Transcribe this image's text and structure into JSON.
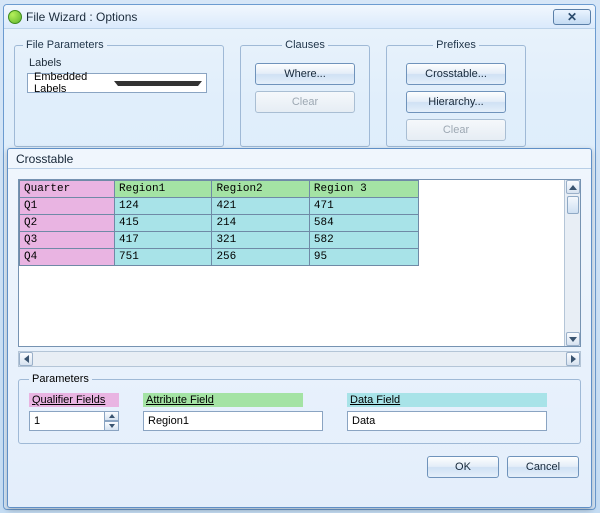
{
  "outer": {
    "title": "File Wizard : Options",
    "close_glyph": "✕",
    "file_parameters": {
      "legend": "File Parameters",
      "labels_caption": "Labels",
      "labels_value": "Embedded Labels"
    },
    "clauses": {
      "legend": "Clauses",
      "where_label": "Where...",
      "clear_label": "Clear"
    },
    "prefixes": {
      "legend": "Prefixes",
      "crosstable_label": "Crosstable...",
      "hierarchy_label": "Hierarchy...",
      "clear_label": "Clear"
    }
  },
  "inner": {
    "title": "Crosstable",
    "headers": {
      "q": "Quarter",
      "r1": "Region1",
      "r2": "Region2",
      "r3": "Region 3"
    },
    "rows": [
      {
        "q": "Q1",
        "r1": "124",
        "r2": "421",
        "r3": "471"
      },
      {
        "q": "Q2",
        "r1": "415",
        "r2": "214",
        "r3": "584"
      },
      {
        "q": "Q3",
        "r1": "417",
        "r2": "321",
        "r3": "582"
      },
      {
        "q": "Q4",
        "r1": "751",
        "r2": "256",
        "r3": "95"
      }
    ],
    "parameters": {
      "legend": "Parameters",
      "qualifier_label": "Qualifier Fields",
      "qualifier_value": "1",
      "attribute_label": "Attribute Field",
      "attribute_value": "Region1",
      "data_label": "Data Field",
      "data_value": "Data"
    },
    "ok_label": "OK",
    "cancel_label": "Cancel"
  },
  "chart_data": {
    "type": "table",
    "title": "Crosstable preview",
    "columns": [
      "Quarter",
      "Region1",
      "Region2",
      "Region 3"
    ],
    "rows": [
      [
        "Q1",
        124,
        421,
        471
      ],
      [
        "Q2",
        415,
        214,
        584
      ],
      [
        "Q3",
        417,
        321,
        582
      ],
      [
        "Q4",
        751,
        256,
        95
      ]
    ]
  }
}
